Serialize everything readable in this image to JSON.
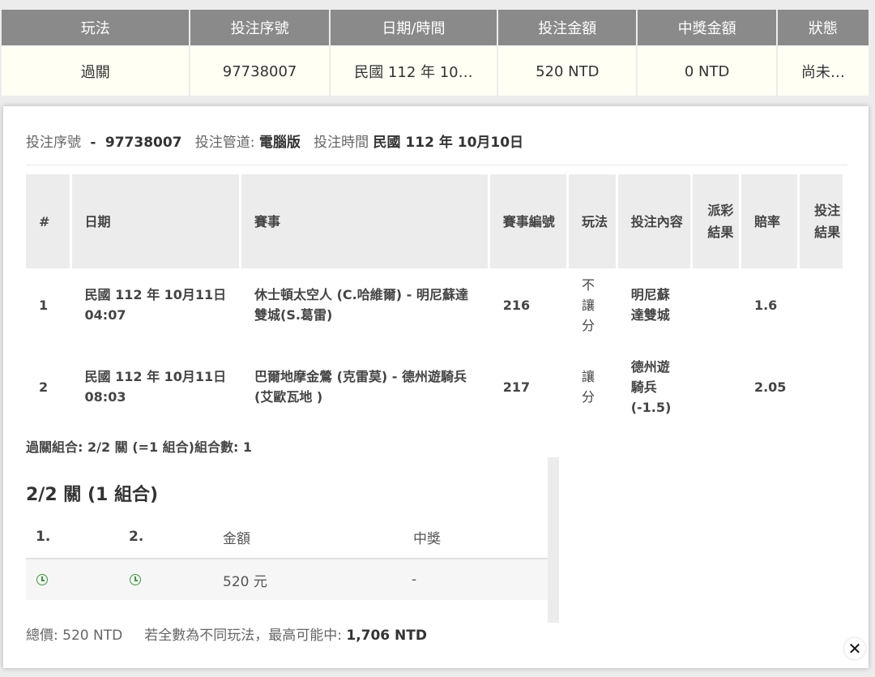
{
  "summary": {
    "headers": [
      "玩法",
      "投注序號",
      "日期/時間",
      "投注金額",
      "中獎金額",
      "狀態"
    ],
    "row": [
      "過關",
      "97738007",
      "民國 112 年 10…",
      "520 NTD",
      "0 NTD",
      "尚未…"
    ]
  },
  "meta": {
    "serial_label": "投注序號",
    "dash": "-",
    "serial_value": "97738007",
    "channel_label": "投注管道:",
    "channel_value": "電腦版",
    "time_label": "投注時間",
    "time_value": "民國 112 年 10月10日"
  },
  "detail": {
    "headers": [
      "#",
      "日期",
      "賽事",
      "賽事編號",
      "玩法",
      "投注內容",
      "派彩結果",
      "賠率",
      "投注結果"
    ],
    "rows": [
      {
        "no": "1",
        "date": "民國 112 年 10月11日",
        "time": "04:07",
        "event": "休士頓太空人 (C.哈維爾) - 明尼蘇達雙城(S.葛雷)",
        "event_no": "216",
        "play": "不讓分",
        "pick": "明尼蘇達雙城",
        "payout": "",
        "odds": "1.6",
        "result": ""
      },
      {
        "no": "2",
        "date": "民國 112 年 10月11日",
        "time": "08:03",
        "event": "巴爾地摩金鶯 (克雷莫) - 德州遊騎兵(艾歐瓦地 )",
        "event_no": "217",
        "play": "讓分",
        "pick": "德州遊騎兵 (-1.5)",
        "payout": "",
        "odds": "2.05",
        "result": ""
      }
    ]
  },
  "combo_info": "過關組合: 2/2 關 (=1 組合)組合數: 1",
  "combo": {
    "title": "2/2 關 (1 組合)",
    "headers": [
      "1.",
      "2.",
      "金額",
      "中獎"
    ],
    "row": {
      "amount": "520 元",
      "win": "-"
    }
  },
  "footer": {
    "total_label": "總價:",
    "total_value": "520 NTD",
    "max_label": "若全數為不同玩法，最高可能中:",
    "max_value": "1,706 NTD"
  },
  "icons": {
    "clock": "clock-icon",
    "close": "close-icon"
  },
  "colors": {
    "header_bg": "#8a8a8a",
    "row_bg": "#fffff4",
    "clock_green": "#3a9a3a"
  }
}
